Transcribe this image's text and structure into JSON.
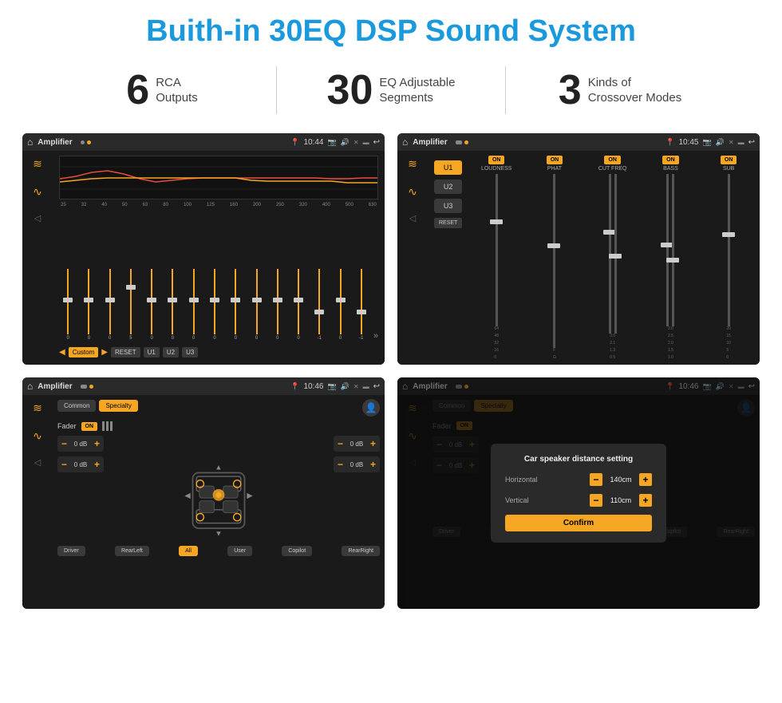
{
  "page": {
    "title": "Buith-in 30EQ DSP Sound System",
    "stats": [
      {
        "number": "6",
        "label": "RCA\nOutputs"
      },
      {
        "number": "30",
        "label": "EQ Adjustable\nSegments"
      },
      {
        "number": "3",
        "label": "Kinds of\nCrossover Modes"
      }
    ]
  },
  "screen1": {
    "title": "Amplifier",
    "time": "10:44",
    "freqs": [
      "25",
      "32",
      "40",
      "50",
      "63",
      "80",
      "100",
      "125",
      "160",
      "200",
      "250",
      "320",
      "400",
      "500",
      "630"
    ],
    "sliderVals": [
      "0",
      "0",
      "0",
      "5",
      "0",
      "0",
      "0",
      "0",
      "0",
      "0",
      "0",
      "0",
      "-1",
      "0",
      "-1"
    ],
    "sliderPositions": [
      50,
      50,
      50,
      30,
      50,
      50,
      50,
      50,
      50,
      50,
      50,
      50,
      70,
      50,
      70
    ],
    "bottomButtons": [
      "Custom",
      "RESET",
      "U1",
      "U2",
      "U3"
    ]
  },
  "screen2": {
    "title": "Amplifier",
    "time": "10:45",
    "uButtons": [
      "U1",
      "U2",
      "U3"
    ],
    "selectedU": "U1",
    "channels": [
      {
        "name": "LOUDNESS",
        "on": true
      },
      {
        "name": "PHAT",
        "on": true
      },
      {
        "name": "CUT FREQ",
        "on": true
      },
      {
        "name": "BASS",
        "on": true
      },
      {
        "name": "SUB",
        "on": true
      }
    ],
    "resetLabel": "RESET"
  },
  "screen3": {
    "title": "Amplifier",
    "time": "10:46",
    "tabs": [
      "Common",
      "Specialty"
    ],
    "activeTab": "Specialty",
    "faderLabel": "Fader",
    "faderOn": true,
    "volumes": [
      "0 dB",
      "0 dB",
      "0 dB",
      "0 dB"
    ],
    "footerButtons": [
      "Driver",
      "RearLeft",
      "All",
      "User",
      "Copilot",
      "RearRight"
    ]
  },
  "screen4": {
    "title": "Amplifier",
    "time": "10:46",
    "tabs": [
      "Common",
      "Specialty"
    ],
    "activeTab": "Specialty",
    "faderOn": true,
    "dialog": {
      "title": "Car speaker distance setting",
      "horizontal": {
        "label": "Horizontal",
        "value": "140cm"
      },
      "vertical": {
        "label": "Vertical",
        "value": "110cm"
      },
      "confirmLabel": "Confirm"
    },
    "volumes": [
      "0 dB",
      "0 dB"
    ],
    "footerButtons": [
      "Driver",
      "RearLeft",
      "All",
      "User",
      "Copilot",
      "RearRight"
    ]
  },
  "icons": {
    "home": "⌂",
    "location": "📍",
    "speaker": "🔊",
    "close": "✕",
    "battery": "▬",
    "back": "↩",
    "eq_icon": "≋",
    "wave_icon": "∿",
    "arrow_down": "▼",
    "arrow_up": "▲",
    "arrow_left": "◀",
    "arrow_right": "▶",
    "plus": "+",
    "minus": "−",
    "person": "👤",
    "settings": "⚙",
    "more": "»"
  }
}
